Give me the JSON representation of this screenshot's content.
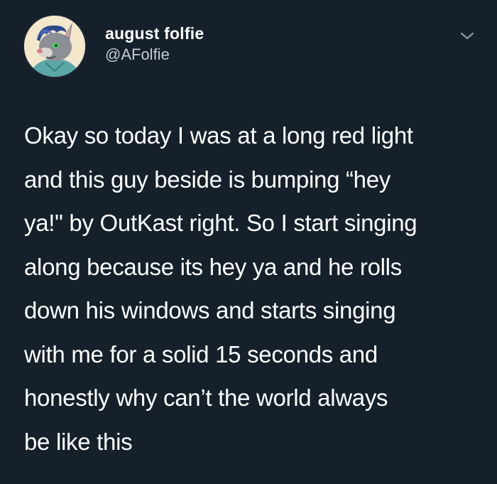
{
  "tweet": {
    "author": {
      "display_name": "august folfie",
      "handle": "@AFolfie",
      "avatar_icon": "avatar-icon"
    },
    "menu_icon": "chevron-down-icon",
    "text": "Okay so today I was at a long red light\nand this guy beside is bumping “hey\nya!\" by OutKast right. So I start singing\nalong because its hey ya and he rolls\ndown his windows and starts singing\nwith me for a solid 15 seconds and\nhonestly why can’t the world always\nbe like this"
  },
  "colors": {
    "background": "#15202b",
    "primary_text": "#ffffff",
    "secondary_text": "#c6ccd3",
    "icon": "#8899a6"
  }
}
